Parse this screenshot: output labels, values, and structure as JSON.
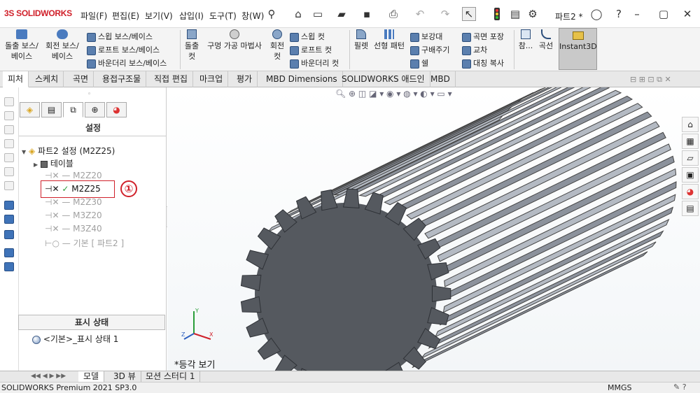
{
  "app": {
    "logo_brand": "SOLIDWORKS",
    "logo_prefix": "3S"
  },
  "menu": [
    "파일(F)",
    "편집(E)",
    "보기(V)",
    "삽입(I)",
    "도구(T)",
    "창(W)"
  ],
  "document_title": "파트2 *",
  "ribbon": {
    "extrude_boss": "돌출 보스/\n베이스",
    "revolve_boss": "회전 보스/\n베이스",
    "sweep_boss": "스윕 보스/베이스",
    "loft_boss": "로프트 보스/베이스",
    "boundary_boss": "바운더리 보스/베이스",
    "extrude_cut": "돌출\n컷",
    "hole_wizard": "구멍 가공 마법사",
    "revolve_cut": "회전\n컷",
    "sweep_cut": "스윕 컷",
    "loft_cut": "로프트 컷",
    "boundary_cut": "바운더리 컷",
    "fillet": "필렛",
    "linear_pattern": "선형 패턴",
    "rib": "보강대",
    "draft": "구배주기",
    "shell": "쉘",
    "wrap": "곡면 포장",
    "intersect": "교차",
    "mirror": "대칭 복사",
    "reference": "참...",
    "curves": "곡선",
    "instant3d": "Instant3D"
  },
  "tabs": [
    "피처",
    "스케치",
    "곡면",
    "용접구조물",
    "직접 편집",
    "마크업",
    "평가",
    "MBD Dimensions",
    "SOLIDWORKS 애드인",
    "MBD"
  ],
  "panel": {
    "title": "설정",
    "root": "파트2 설정  (M2Z25)",
    "tables": "테이블",
    "configs": [
      "M2Z20",
      "M2Z25",
      "M2Z30",
      "M3Z20",
      "M3Z40",
      "기본 [ 파트2 ]"
    ],
    "active_config": "M2Z25",
    "callout": "①",
    "display_state_header": "표시 상태",
    "display_state_item": "<기본>_표시 상태 1"
  },
  "viewport": {
    "view_label": "*등각 보기"
  },
  "bottom_tabs": [
    "모델",
    "3D 뷰",
    "모션 스터디 1"
  ],
  "status": {
    "version": "SOLIDWORKS Premium 2021 SP3.0",
    "units": "MMGS"
  },
  "colors": {
    "accent_red": "#d0202a",
    "gear_face": "#55595f",
    "gear_teeth": "#8c929c"
  }
}
